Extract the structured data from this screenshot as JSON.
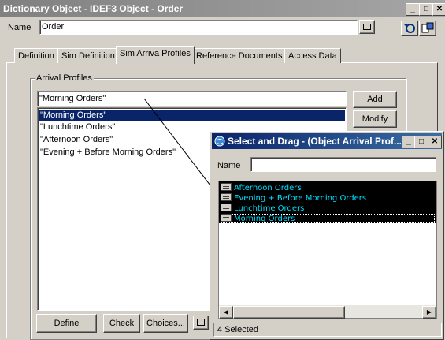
{
  "window": {
    "title": "Dictionary Object - IDEF3 Object - Order",
    "min_label": "_",
    "max_label": "□",
    "close_label": "✕"
  },
  "name_label": "Name",
  "name_value": "Order",
  "tabs": [
    {
      "label": "Definition"
    },
    {
      "label": "Sim Definition"
    },
    {
      "label": "Sim Arriva Profiles"
    },
    {
      "label": "Reference Documents"
    },
    {
      "label": "Access Data"
    }
  ],
  "arrival_profiles": {
    "group_label": "Arrival Profiles",
    "input_value": "\"Morning Orders\"",
    "items": [
      {
        "label": "\"Morning Orders\""
      },
      {
        "label": "\"Lunchtime Orders\""
      },
      {
        "label": "\"Afternoon Orders\""
      },
      {
        "label": "\"Evening + Before Morning Orders\""
      }
    ],
    "selected_index": 0,
    "add_label": "Add",
    "modify_label": "Modify"
  },
  "bottom_buttons": {
    "define": "Define",
    "check": "Check",
    "choices": "Choices..."
  },
  "dialog": {
    "title": "Select and Drag - (Object Arrival Prof...",
    "name_label": "Name",
    "name_value": "",
    "items": [
      {
        "label": "Afternoon Orders"
      },
      {
        "label": "Evening + Before Morning Orders"
      },
      {
        "label": "Lunchtime Orders"
      },
      {
        "label": "Morning Orders"
      }
    ],
    "status": "4 Selected"
  }
}
